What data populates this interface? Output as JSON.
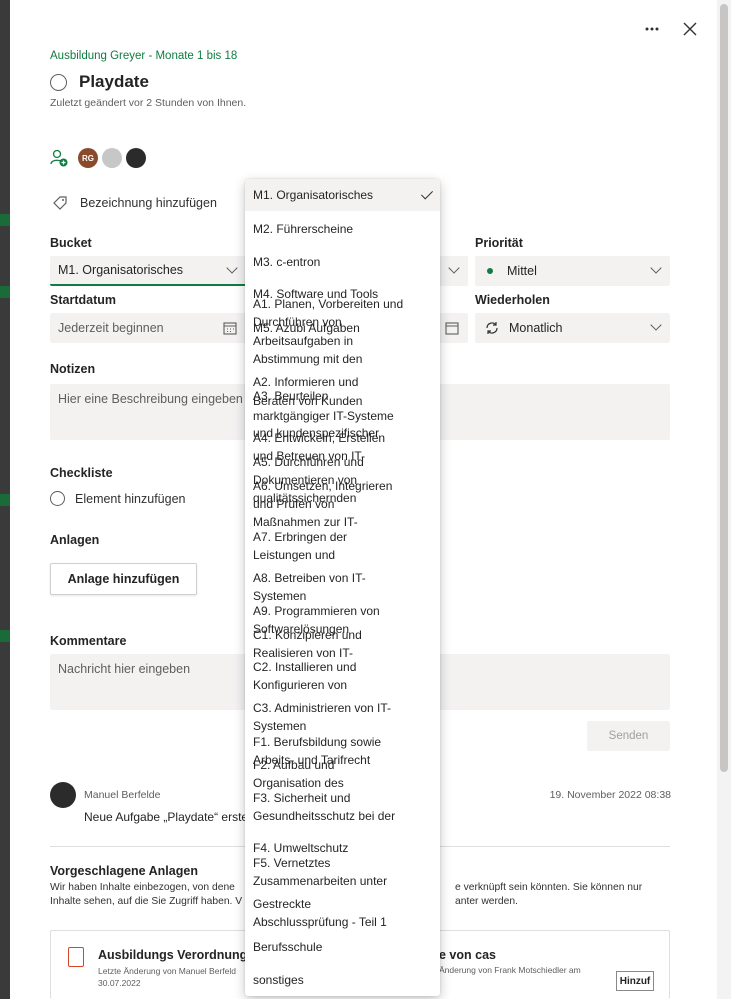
{
  "header": {
    "more_icon": "more-horizontal-icon",
    "close_icon": "close-icon"
  },
  "task": {
    "plan_name": "Ausbildung Greyer - Monate 1 bis 18",
    "title": "Playdate",
    "modified": "Zuletzt geändert vor 2 Stunden von Ihnen.",
    "add_label": "Bezeichnung hinzufügen"
  },
  "assignees": [
    {
      "initials": "RG"
    },
    {
      "initials": ""
    },
    {
      "initials": ""
    }
  ],
  "fields": {
    "bucket_label": "Bucket",
    "bucket_value": "M1. Organisatorisches",
    "priority_label": "Priorität",
    "priority_value": "Mittel",
    "start_label": "Startdatum",
    "start_placeholder": "Jederzeit beginnen",
    "repeat_label": "Wiederholen",
    "repeat_value": "Monatlich"
  },
  "notes": {
    "label": "Notizen",
    "placeholder": "Hier eine Beschreibung eingeben"
  },
  "checklist": {
    "label": "Checkliste",
    "add_item": "Element hinzufügen"
  },
  "attachments": {
    "label": "Anlagen",
    "button": "Anlage hinzufügen"
  },
  "comments": {
    "label": "Kommentare",
    "placeholder": "Nachricht hier eingeben",
    "send": "Senden",
    "author": "Manuel Berfelde",
    "date": "19. November 2022 08:38",
    "text": "Neue Aufgabe „Playdate“ erste"
  },
  "suggested": {
    "title": "Vorgeschlagene Anlagen",
    "desc_left": "Wir haben Inhalte einbezogen, von dene",
    "desc_right": "e verknüpft sein könnten. Sie können nur",
    "desc2_left": "Inhalte sehen, auf die Sie Zugriff haben. V",
    "desc2_right": "anter werden.",
    "card1_title": "Ausbildungs Verordnung",
    "card1_sub": "Letzte Änderung von Manuel Berfeld",
    "card1_date": "30.07.2022",
    "card2_title": "e von cas",
    "card2_sub": "Änderung von Frank Motschiedler am",
    "card2_button": "Hinzuf"
  },
  "dropdown": {
    "items": [
      "M1. Organisatorisches",
      "M2. Führerscheine",
      "M3. c-entron",
      "M4. Software und Tools",
      "A1. Planen, Vorbereiten und Durchführen von",
      "M5. Azubi Aufgaben",
      "Arbeitsaufgaben in",
      "Abstimmung mit den",
      "A2. Informieren und",
      "A3. Beurteilen",
      "Beraten von Kunden",
      "marktgängiger IT-Systeme",
      "und kundenspezifischer",
      "A4. Entwickeln, Erstellen",
      "und Betreuen von IT-",
      "A5. Durchführen und",
      "Dokumentieren von",
      "A6. Umsetzen, Integrieren",
      "qualitätssichernden",
      "und Prüfen von",
      "Maßnahmen zur IT-",
      "A7. Erbringen der",
      "Leistungen und",
      "A8. Betreiben von IT-",
      "Systemen",
      "A9. Programmieren von",
      "Softwarelösungen",
      "C1. Konzipieren und",
      "Realisieren von IT-",
      "C2. Installieren und",
      "Konfigurieren von",
      "C3. Administrieren von IT-",
      "Systemen",
      "F1. Berufsbildung sowie",
      "Arbeits- und Tarifrecht",
      "F2. Aufbau und",
      "Organisation des",
      "F3. Sicherheit und",
      "Gesundheitsschutz bei der",
      "F4. Umweltschutz",
      "F5. Vernetztes",
      "Zusammenarbeiten unter",
      "Gestreckte",
      "Abschlussprüfung - Teil 1",
      "Berufsschule",
      "sonstiges"
    ]
  }
}
